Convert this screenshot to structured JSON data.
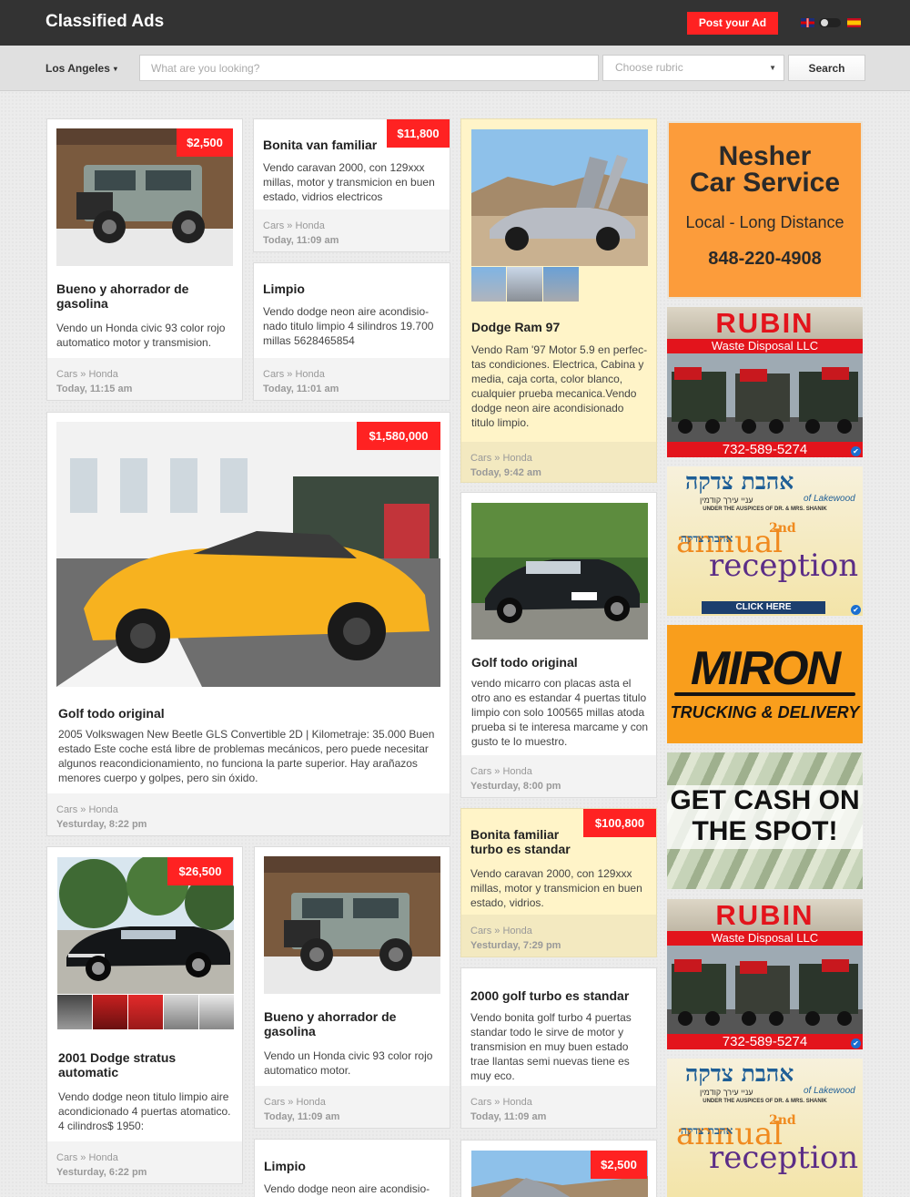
{
  "header": {
    "brand": "Classified Ads",
    "post_button": "Post your Ad"
  },
  "search": {
    "city": "Los Angeles",
    "placeholder": "What are you looking?",
    "rubric_placeholder": "Choose rubric",
    "button": "Search"
  },
  "cards": [
    {
      "title": "Bueno y ahorrador de gasolina",
      "price": "$2,500",
      "desc": "Vendo un Honda civic 93 color rojo automatico motor y transmision.",
      "category": "Cars » Honda",
      "time": "Today, 11:15 am"
    },
    {
      "title": "Bonita van familiar",
      "price": "$11,800",
      "desc": "Vendo caravan 2000, con 129xxx millas, motor y transmicion en buen estado, vidrios electricos",
      "category": "Cars » Honda",
      "time": "Today, 11:09 am"
    },
    {
      "title": "Limpio",
      "desc": "Vendo dodge neon aire acondisio-nado titulo limpio 4 silindros 19.700 millas 5628465854",
      "category": "Cars » Honda",
      "time": "Today, 11:01 am"
    },
    {
      "title": "Dodge Ram 97",
      "desc": "Vendo Ram '97 Motor 5.9 en perfec-tas condiciones. Electrica, Cabina y media, caja corta, color blanco, cualquier prueba mecanica.Vendo dodge neon aire acondisionado titulo limpio.",
      "category": "Cars » Honda",
      "time": "Today, 9:42 am"
    },
    {
      "title": "Golf todo original",
      "price": "$1,580,000",
      "desc": "2005 Volkswagen New Beetle GLS Convertible 2D | Kilometraje: 35.000 Buen estado Este coche está libre de problemas mecánicos, pero puede necesitar algunos reacondicionamiento, no funciona la parte superior. Hay arañazos menores cuerpo y golpes, pero sin óxido.",
      "category": "Cars » Honda",
      "time": "Yesturday, 8:22 pm"
    },
    {
      "title": "Golf todo original",
      "desc": "vendo micarro con placas asta el otro ano es estandar 4 puertas titulo limpio con solo 100565 millas atoda prueba si te interesa marcame y con gusto te lo muestro.",
      "category": "Cars » Honda",
      "time": "Yesturday, 8:00 pm"
    },
    {
      "title": "Bonita familiar turbo es standar",
      "price": "$100,800",
      "desc": "Vendo caravan 2000, con 129xxx millas, motor y transmicion en buen estado, vidrios.",
      "category": "Cars » Honda",
      "time": "Yesturday, 7:29 pm"
    },
    {
      "title": "2001 Dodge stratus automatic",
      "price": "$26,500",
      "desc": "Vendo dodge neon titulo limpio aire acondicionado 4 puertas atomatico. 4 cilindros$ 1950:",
      "category": "Cars » Honda",
      "time": "Yesturday, 6:22 pm"
    },
    {
      "title": "Bueno y ahorrador de gasolina",
      "desc": "Vendo un Honda civic 93 color rojo automatico motor.",
      "category": "Cars » Honda",
      "time": "Today, 11:09 am"
    },
    {
      "title": "2000 golf turbo es standar",
      "desc": "Vendo bonita golf turbo 4 puertas standar todo le sirve de motor y transmision en muy buen estado trae llantas semi nuevas tiene es muy eco.",
      "category": "Cars » Honda",
      "time": "Today, 11:09 am"
    },
    {
      "title": "Limpio",
      "desc": "Vendo dodge neon aire acondisio-"
    },
    {
      "price": "$2,500"
    }
  ],
  "ads": {
    "nesher": {
      "line1": "Nesher",
      "line2": "Car Service",
      "sub": "Local - Long Distance",
      "phone": "848-220-4908"
    },
    "rubin": {
      "name": "RUBIN",
      "sub": "Waste Disposal LLC",
      "phone": "732-589-5274"
    },
    "ahavas": {
      "hebrew": "אהבת צדקה",
      "small": "עניי עירך קודמין",
      "of": "of Lakewood",
      "under": "UNDER THE AUSPICES OF DR. & MRS. SHANIK",
      "nth": "2nd",
      "annual": "annual",
      "reception": "reception",
      "hebrew_small": "אהבת צדקה",
      "cta": "CLICK HERE"
    },
    "miron": {
      "name": "MIRON",
      "sub": "TRUCKING & DELIVERY"
    },
    "cash": {
      "line1": "GET CASH ON",
      "line2": "THE SPOT!"
    }
  },
  "colors": {
    "accent": "#ff2222",
    "topbar": "#333333",
    "nesher_orange": "#fc9c3b",
    "miron_orange": "#f99e1c",
    "highlight_card": "#fff4c8"
  },
  "icons": {
    "city_caret": "▾",
    "rubric_caret": "▼",
    "verified": "✔"
  }
}
